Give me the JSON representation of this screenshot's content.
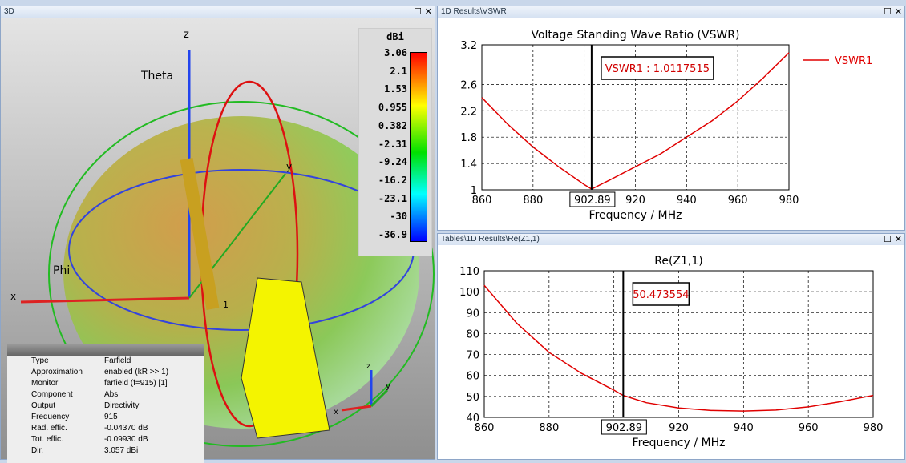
{
  "panels": {
    "view3d": "3D",
    "vswr": "1D Results\\VSWR",
    "rez": "Tables\\1D Results\\Re(Z1,1)"
  },
  "window_buttons": {
    "maximize": "☐",
    "close": "✕"
  },
  "view3d": {
    "axes": {
      "z": "z",
      "x": "x",
      "y": "y",
      "theta": "Theta",
      "phi": "Phi",
      "port": "1"
    },
    "colorbar": {
      "unit": "dBi",
      "ticks": [
        "3.06",
        "2.1",
        "1.53",
        "0.955",
        "0.382",
        "-2.31",
        "-9.24",
        "-16.2",
        "-23.1",
        "-30",
        "-36.9"
      ]
    },
    "info": [
      [
        "Type",
        "Farfield"
      ],
      [
        "Approximation",
        "enabled (kR >> 1)"
      ],
      [
        "Monitor",
        "farfield (f=915) [1]"
      ],
      [
        "Component",
        "Abs"
      ],
      [
        "Output",
        "Directivity"
      ],
      [
        "Frequency",
        "915"
      ],
      [
        "Rad. effic.",
        "-0.04370 dB"
      ],
      [
        "Tot. effic.",
        "-0.09930 dB"
      ],
      [
        "Dir.",
        "3.057 dBi"
      ]
    ]
  },
  "chart_data": [
    {
      "type": "line",
      "title": "Voltage Standing Wave Ratio (VSWR)",
      "xlabel": "Frequency / MHz",
      "ylabel": "",
      "xlim": [
        860,
        980
      ],
      "ylim": [
        1,
        3.2
      ],
      "xticks": [
        "860",
        "880",
        "900",
        "920",
        "940",
        "960",
        "980"
      ],
      "yticks": [
        "1",
        "1.4",
        "1.8",
        "2.2",
        "2.6",
        "3.2"
      ],
      "ytick_values": [
        1,
        1.4,
        1.8,
        2.2,
        2.6,
        3.2
      ],
      "grid": true,
      "legend": "right",
      "series": [
        {
          "name": "VSWR1",
          "color": "#e00000",
          "x": [
            860,
            870,
            880,
            890,
            900,
            902.89,
            910,
            920,
            930,
            940,
            950,
            960,
            970,
            980
          ],
          "y": [
            2.4,
            2.0,
            1.65,
            1.35,
            1.08,
            1.012,
            1.15,
            1.35,
            1.55,
            1.8,
            2.05,
            2.35,
            2.7,
            3.08
          ]
        }
      ],
      "marker": {
        "x": 902.89,
        "x_label": "902.89",
        "label": "VSWR1 : 1.0117515"
      }
    },
    {
      "type": "line",
      "title": "Re(Z1,1)",
      "xlabel": "Frequency / MHz",
      "ylabel": "",
      "xlim": [
        860,
        980
      ],
      "ylim": [
        40,
        110
      ],
      "xticks": [
        "860",
        "880",
        "900",
        "920",
        "940",
        "960",
        "980"
      ],
      "yticks": [
        "40",
        "50",
        "60",
        "70",
        "80",
        "90",
        "100",
        "110"
      ],
      "ytick_values": [
        40,
        50,
        60,
        70,
        80,
        90,
        100,
        110
      ],
      "grid": true,
      "legend": "none",
      "series": [
        {
          "name": "Re(Z1,1)",
          "color": "#e00000",
          "x": [
            860,
            870,
            880,
            890,
            900,
            902.89,
            910,
            920,
            930,
            940,
            950,
            960,
            970,
            980
          ],
          "y": [
            103,
            85,
            71,
            61,
            53,
            50.47,
            47,
            44.5,
            43.3,
            43,
            43.5,
            45,
            47.5,
            50.5
          ]
        }
      ],
      "marker": {
        "x": 902.89,
        "x_label": "902.89",
        "label": "50.473554"
      }
    }
  ]
}
